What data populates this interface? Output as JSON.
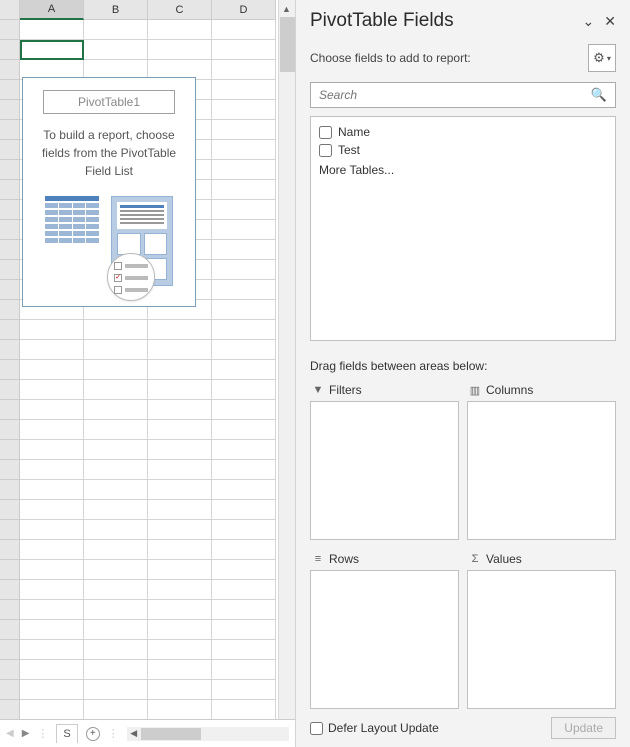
{
  "columns": [
    "A",
    "B",
    "C",
    "D"
  ],
  "selected_column": "A",
  "pivot_placeholder": {
    "title": "PivotTable1",
    "instruction_l1": "To build a report, choose",
    "instruction_l2": "fields from the PivotTable",
    "instruction_l3": "Field List"
  },
  "sheet_tab": "S",
  "pane": {
    "title": "PivotTable Fields",
    "subtitle": "Choose fields to add to report:",
    "search_placeholder": "Search",
    "fields": [
      {
        "label": "Name",
        "checked": false
      },
      {
        "label": "Test",
        "checked": false
      }
    ],
    "more_tables": "More Tables...",
    "drag_label": "Drag fields between areas below:",
    "areas": {
      "filters": "Filters",
      "columns": "Columns",
      "rows": "Rows",
      "values": "Values"
    },
    "defer_label": "Defer Layout Update",
    "update_label": "Update"
  }
}
